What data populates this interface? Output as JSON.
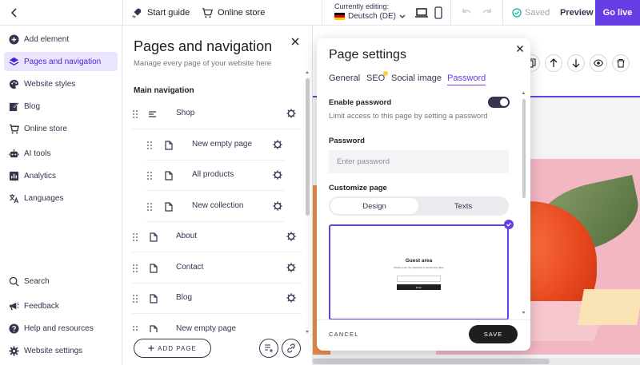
{
  "topbar": {
    "start_guide": "Start guide",
    "online_store": "Online store",
    "currently_editing": "Currently editing:",
    "language": "Deutsch (DE)",
    "saved": "Saved",
    "preview": "Preview",
    "go_live": "Go live"
  },
  "sidebar": {
    "items": [
      {
        "label": "Add element",
        "icon": "plus-circle-icon"
      },
      {
        "label": "Pages and navigation",
        "icon": "layers-icon",
        "active": true
      },
      {
        "label": "Website styles",
        "icon": "palette-icon"
      },
      {
        "label": "Blog",
        "icon": "edit-icon"
      },
      {
        "label": "Online store",
        "icon": "cart-icon"
      },
      {
        "label": "AI tools",
        "icon": "robot-icon"
      },
      {
        "label": "Analytics",
        "icon": "chart-icon"
      },
      {
        "label": "Languages",
        "icon": "translate-icon"
      }
    ],
    "bottom": [
      {
        "label": "Search",
        "icon": "search-icon"
      },
      {
        "label": "Feedback",
        "icon": "megaphone-icon"
      },
      {
        "label": "Help and resources",
        "icon": "help-icon"
      },
      {
        "label": "Website settings",
        "icon": "gear-icon"
      }
    ]
  },
  "pages_panel": {
    "title": "Pages and navigation",
    "subtitle": "Manage every page of your website here",
    "section": "Main navigation",
    "pages": [
      {
        "label": "Shop",
        "indent": 0,
        "icon": "menu-icon"
      },
      {
        "label": "New empty page",
        "indent": 1,
        "icon": "page-icon"
      },
      {
        "label": "All products",
        "indent": 1,
        "icon": "page-icon"
      },
      {
        "label": "New collection",
        "indent": 1,
        "icon": "page-icon"
      },
      {
        "label": "About",
        "indent": 0,
        "icon": "page-icon"
      },
      {
        "label": "Contact",
        "indent": 0,
        "icon": "page-icon"
      },
      {
        "label": "Blog",
        "indent": 0,
        "icon": "page-icon"
      },
      {
        "label": "New empty page",
        "indent": 0,
        "icon": "page-icon"
      }
    ],
    "add_page": "ADD PAGE"
  },
  "modal": {
    "title": "Page settings",
    "tabs": [
      "General",
      "SEO",
      "Social image",
      "Password"
    ],
    "active_tab": "Password",
    "enable_password_label": "Enable password",
    "enable_password_desc": "Limit access to this page by setting a password",
    "password_enabled": true,
    "password_label": "Password",
    "password_placeholder": "Enter password",
    "customize_label": "Customize page",
    "customize_options": [
      "Design",
      "Texts"
    ],
    "customize_selected": "Design",
    "preview_title": "Guest area",
    "preview_sub": "Please enter the password to access this page",
    "preview_button": "Enter",
    "cancel": "CANCEL",
    "save": "SAVE"
  },
  "colors": {
    "accent": "#673de6",
    "accent_light": "#ebe4ff",
    "dark": "#1d1e20",
    "seo_dot": "#ffcd35"
  }
}
